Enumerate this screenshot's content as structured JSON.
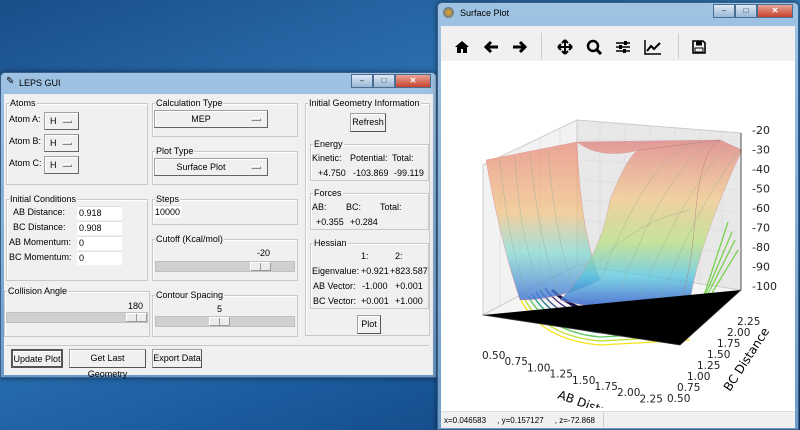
{
  "leps": {
    "title": "LEPS GUI",
    "atoms": {
      "label": "Atoms",
      "a_label": "Atom A:",
      "b_label": "Atom B:",
      "c_label": "Atom C:",
      "a": "H",
      "b": "H",
      "c": "H"
    },
    "initial": {
      "label": "Initial Conditions",
      "ab_dist_label": "AB Distance:",
      "bc_dist_label": "BC Distance:",
      "ab_mom_label": "AB Momentum:",
      "bc_mom_label": "BC Momentum:",
      "ab_dist": "0.918",
      "bc_dist": "0.908",
      "ab_mom": "0",
      "bc_mom": "0"
    },
    "collision": {
      "label": "Collision Angle",
      "value": "180",
      "fraction": 1.0
    },
    "calc": {
      "label": "Calculation Type",
      "value": "MEP"
    },
    "plot_type": {
      "label": "Plot Type",
      "value": "Surface Plot"
    },
    "steps": {
      "label": "Steps",
      "value": "10000"
    },
    "cutoff": {
      "label": "Cutoff (Kcal/mol)",
      "value": "-20",
      "fraction": 0.8
    },
    "contour": {
      "label": "Contour Spacing",
      "value": "5",
      "fraction": 0.45
    },
    "geom": {
      "label": "Initial Geometry Information",
      "refresh": "Refresh",
      "energy": {
        "label": "Energy",
        "kinetic_label": "Kinetic:",
        "potential_label": "Potential:",
        "total_label": "Total:",
        "kinetic": "+4.750",
        "potential": "-103.869",
        "total": "-99.119"
      },
      "forces": {
        "label": "Forces",
        "ab_label": "AB:",
        "bc_label": "BC:",
        "total_label": "Total:",
        "ab": "+0.355",
        "bc": "+0.284"
      },
      "hessian": {
        "label": "Hessian",
        "col1": "1:",
        "col2": "2:",
        "eig_label": "Eigenvalue:",
        "abv_label": "AB Vector:",
        "bcv_label": "BC Vector:",
        "eig1": "+0.921",
        "eig2": "+823.587",
        "abv1": "-1.000",
        "abv2": "+0.001",
        "bcv1": "+0.001",
        "bcv2": "+1.000"
      },
      "plot": "Plot"
    },
    "buttons": {
      "update": "Update Plot",
      "last_geom": "Get Last Geometry",
      "export": "Export Data"
    }
  },
  "surface": {
    "title": "Surface Plot",
    "status": "x=0.046583     , y=0.157127     , z=-72.868",
    "z_ticks": [
      "-20",
      "-30",
      "-40",
      "-50",
      "-60",
      "-70",
      "-80",
      "-90",
      "-100"
    ],
    "ab_ticks": [
      "0.50",
      "0.75",
      "1.00",
      "1.25",
      "1.50",
      "1.75",
      "2.00",
      "2.25"
    ],
    "bc_ticks": [
      "0.50",
      "0.75",
      "1.00",
      "1.25",
      "1.50",
      "1.75",
      "2.00",
      "2.25"
    ],
    "ab_label": "AB Distance",
    "bc_label": "BC Distance"
  }
}
